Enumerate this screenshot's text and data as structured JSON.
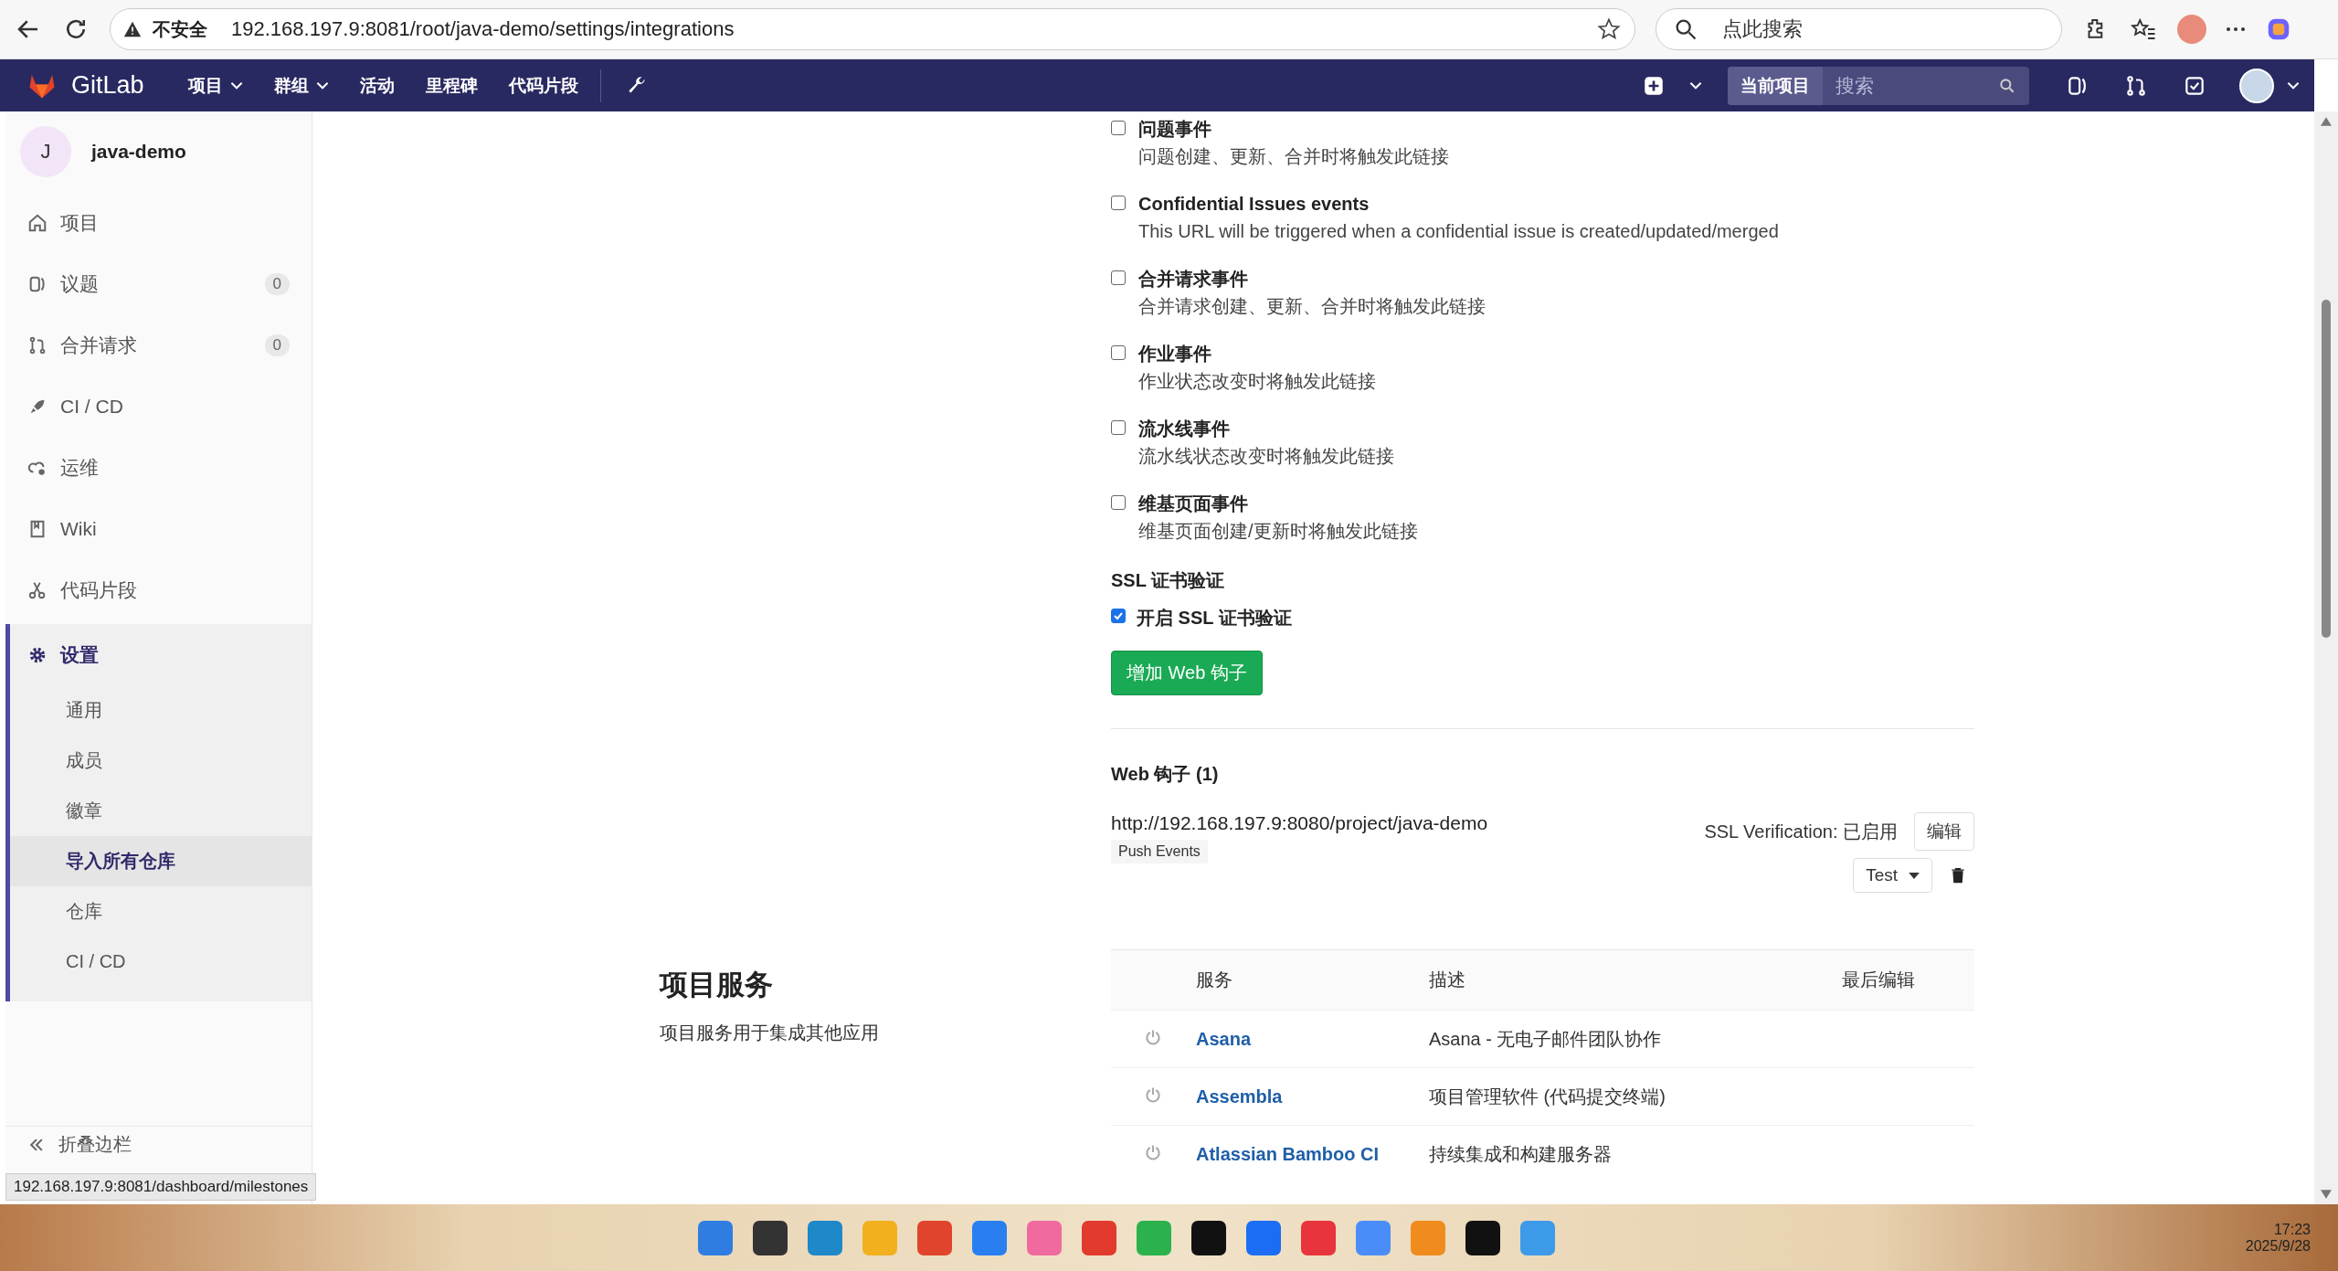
{
  "browser": {
    "security_label": "不安全",
    "url": "192.168.197.9:8081/root/java-demo/settings/integrations",
    "search_placeholder": "点此搜索"
  },
  "navbar": {
    "brand": "GitLab",
    "items": [
      {
        "label": "项目",
        "dropdown": true
      },
      {
        "label": "群组",
        "dropdown": true
      },
      {
        "label": "活动",
        "dropdown": false
      },
      {
        "label": "里程碑",
        "dropdown": false
      },
      {
        "label": "代码片段",
        "dropdown": false
      }
    ],
    "search_scope": "当前项目",
    "search_placeholder": "搜索"
  },
  "sidebar": {
    "project_initial": "J",
    "project_name": "java-demo",
    "items": [
      {
        "label": "项目",
        "selected": false
      },
      {
        "label": "议题",
        "count": "0",
        "selected": false
      },
      {
        "label": "合并请求",
        "count": "0",
        "selected": false
      },
      {
        "label": "CI / CD",
        "selected": false
      },
      {
        "label": "运维",
        "selected": false
      },
      {
        "label": "Wiki",
        "selected": false
      },
      {
        "label": "代码片段",
        "selected": false
      },
      {
        "label": "设置",
        "selected": true,
        "children": [
          {
            "label": "通用",
            "selected": false
          },
          {
            "label": "成员",
            "selected": false
          },
          {
            "label": "徽章",
            "selected": false
          },
          {
            "label": "导入所有仓库",
            "selected": true
          },
          {
            "label": "仓库",
            "selected": false
          },
          {
            "label": "CI / CD",
            "selected": false
          }
        ]
      }
    ],
    "collapse_label": "折叠边栏"
  },
  "events": [
    {
      "label": "问题事件",
      "description": "问题创建、更新、合并时将触发此链接",
      "checked": false
    },
    {
      "label": "Confidential Issues events",
      "description": "This URL will be triggered when a confidential issue is created/updated/merged",
      "checked": false
    },
    {
      "label": "合并请求事件",
      "description": "合并请求创建、更新、合并时将触发此链接",
      "checked": false
    },
    {
      "label": "作业事件",
      "description": "作业状态改变时将触发此链接",
      "checked": false
    },
    {
      "label": "流水线事件",
      "description": "流水线状态改变时将触发此链接",
      "checked": false
    },
    {
      "label": "维基页面事件",
      "description": "维基页面创建/更新时将触发此链接",
      "checked": false
    }
  ],
  "ssl": {
    "heading": "SSL 证书验证",
    "label": "开启 SSL 证书验证",
    "checked": true
  },
  "add_button": "增加 Web 钩子",
  "webhooks": {
    "heading": "Web 钩子 (1)",
    "items": [
      {
        "url": "http://192.168.197.9:8080/project/java-demo",
        "tags": [
          "Push Events"
        ],
        "ssl_status": "SSL Verification: 已启用",
        "edit": "编辑",
        "test": "Test"
      }
    ]
  },
  "services": {
    "title": "项目服务",
    "description": "项目服务用于集成其他应用",
    "columns": [
      "服务",
      "描述",
      "最后编辑"
    ],
    "rows": [
      {
        "name": "Asana",
        "description": "Asana - 无电子邮件团队协作",
        "active": false
      },
      {
        "name": "Assembla",
        "description": "项目管理软件 (代码提交终端)",
        "active": false
      },
      {
        "name": "Atlassian Bamboo CI",
        "description": "持续集成和构建服务器",
        "active": false
      }
    ]
  },
  "status_tooltip": "192.168.197.9:8081/dashboard/milestones",
  "taskbar": {
    "time": "17:23",
    "date": "2025/9/28"
  }
}
